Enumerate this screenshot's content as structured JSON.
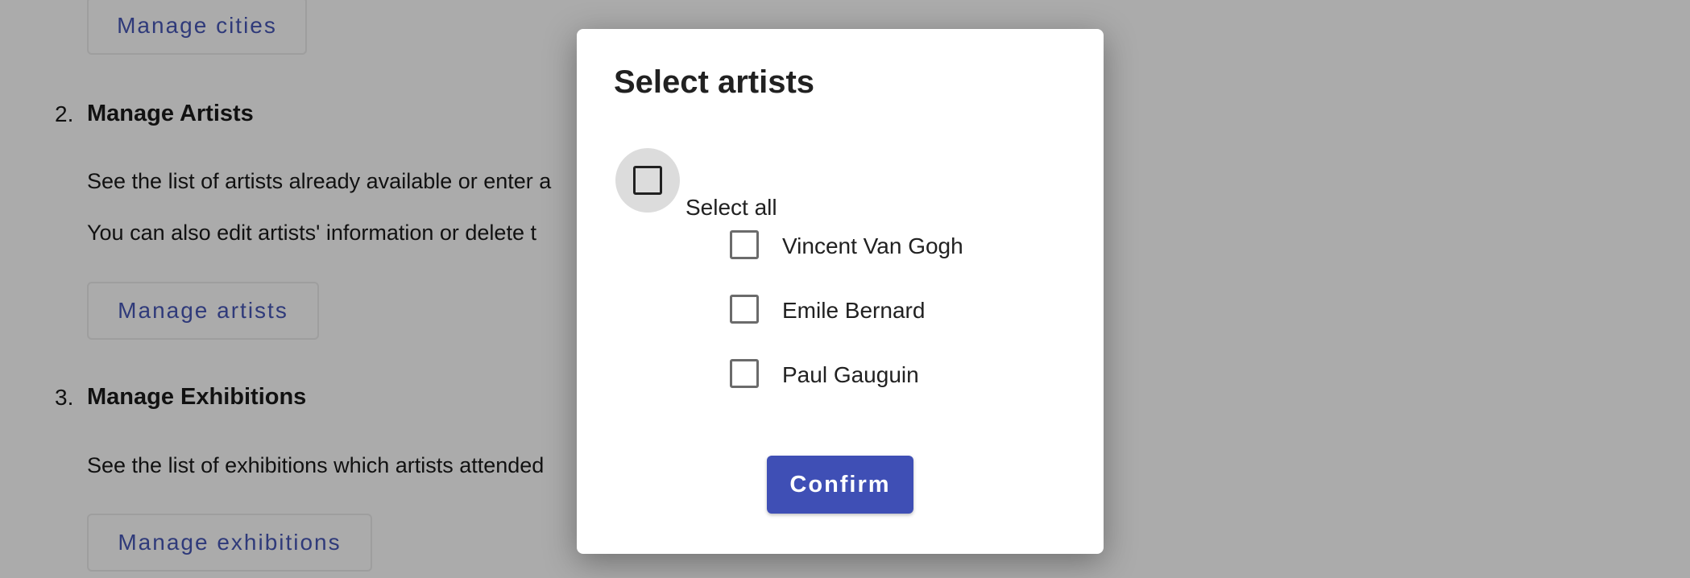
{
  "background": {
    "manage_cities_button": "Manage cities",
    "sections": [
      {
        "number": "2.",
        "title": "Manage Artists",
        "lines": [
          "See the list of artists already available or enter a",
          "You can also edit artists' information or delete t"
        ],
        "button": "Manage artists"
      },
      {
        "number": "3.",
        "title": "Manage Exhibitions",
        "lines": [
          "See the list of exhibitions which artists attended"
        ],
        "button": "Manage exhibitions"
      }
    ]
  },
  "dialog": {
    "title": "Select artists",
    "select_all_label": "Select all",
    "artists": [
      "Vincent Van Gogh",
      "Emile Bernard",
      "Paul Gauguin"
    ],
    "confirm_label": "Confirm"
  },
  "colors": {
    "overlay": "#ababab",
    "primary": "#3f4fb5",
    "outline_text": "#2f3a7a"
  }
}
